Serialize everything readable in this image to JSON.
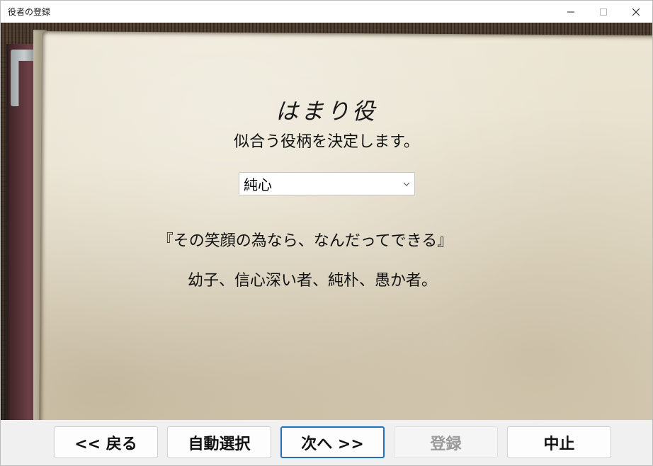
{
  "window": {
    "title": "役者の登録",
    "controls": {
      "minimize_icon": "minimize-icon",
      "maximize_icon": "maximize-icon",
      "close_icon": "close-icon"
    }
  },
  "page": {
    "heading": "はまり役",
    "subheading": "似合う役柄を決定します。",
    "role_select": {
      "value": "純心",
      "icon": "chevron-down-icon"
    },
    "quote": "『その笑顔の為なら、なんだってできる』",
    "description": "幼子、信心深い者、純朴、愚か者。"
  },
  "buttons": {
    "back": "<< 戻る",
    "auto_select": "自動選択",
    "next": "次へ >>",
    "register": "登録",
    "cancel": "中止"
  }
}
